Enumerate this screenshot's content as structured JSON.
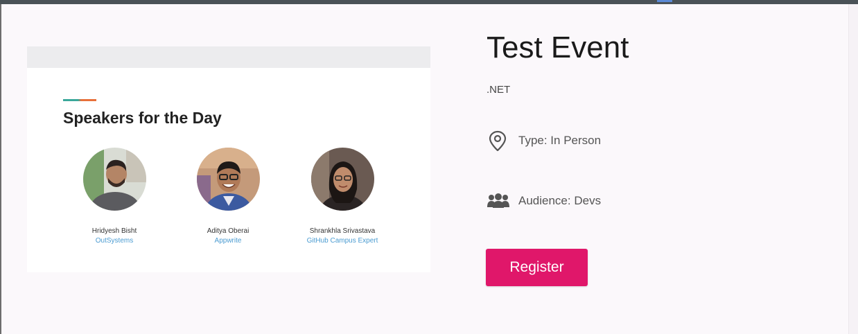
{
  "event": {
    "title": "Test Event",
    "tag": ".NET",
    "type_text": "Type: In Person",
    "audience_text": "Audience: Devs",
    "register_label": "Register"
  },
  "banner": {
    "heading": "Speakers for the Day",
    "speakers": [
      {
        "name": "Hridyesh Bisht",
        "org": "OutSystems"
      },
      {
        "name": "Aditya Oberai",
        "org": "Appwrite"
      },
      {
        "name": "Shrankhla Srivastava",
        "org": "GitHub Campus Expert"
      }
    ]
  },
  "colors": {
    "register_button": "#e0176a",
    "org_link": "#4a9bd1",
    "accent_teal": "#3aa89a",
    "accent_orange": "#e8703a"
  },
  "icons": {
    "type": "map-pin-icon",
    "audience": "users-icon"
  }
}
